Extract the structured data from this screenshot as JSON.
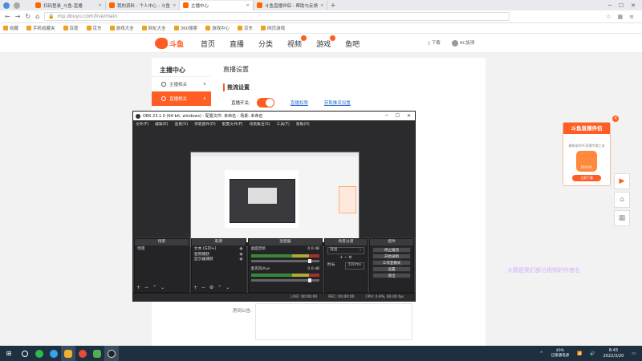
{
  "browser": {
    "tabs": [
      {
        "label": "扫码登录_斗鱼-直播",
        "active": false
      },
      {
        "label": "我的资料 - 个人中心 - 斗鱼",
        "active": false
      },
      {
        "label": "主播中心",
        "active": true
      },
      {
        "label": "斗鱼直播伴侣 - 帮助与反馈",
        "active": false
      }
    ],
    "new_tab": "+",
    "url": "mp.douyu.com/live/main",
    "bookmarks": [
      "收藏",
      "手机收藏夹",
      "百度",
      "京东",
      "游戏大全",
      "网址大全",
      "360搜索",
      "游戏中心",
      "京东",
      "网页游戏"
    ]
  },
  "douyu": {
    "logo_text": "斗鱼",
    "nav": [
      "首页",
      "直播",
      "分类",
      "视频",
      "游戏",
      "鱼吧"
    ],
    "right": {
      "download": "下载",
      "user": "AC旋律"
    },
    "sidebar_title": "主播中心",
    "sidebar_items": [
      {
        "label": "主播相关",
        "arrow": "∧"
      },
      {
        "label": "直播相关",
        "arrow": "∧"
      }
    ],
    "content_title": "直播设置",
    "section_title": "推流设置",
    "toggle_label": "直播开关:",
    "links": [
      "直播权限",
      "获取推流设置"
    ],
    "notice_label": "房间公告:"
  },
  "ad": {
    "title": "斗鱼直播伴侣",
    "subtitle": "最新版的PC直播专属工具",
    "app_label": "DOUYU",
    "download": "立即下载",
    "close": "×"
  },
  "watermark": "大鹅是我们部分视频的作者名",
  "obs": {
    "title": "OBS 23.1.0 (64-bit, windows) - 配置文件: 未命名 - 场景: 未命名",
    "menu": [
      "文件(F)",
      "编辑(E)",
      "查看(V)",
      "停靠部件(D)",
      "配置文件(P)",
      "场景集合(S)",
      "工具(T)",
      "帮助(H)"
    ],
    "docks": {
      "scenes": {
        "header": "场景",
        "items": [
          "场景"
        ]
      },
      "sources": {
        "header": "来源",
        "items": [
          "文本 (GDI+)",
          "音频捕获",
          "显示器捕获"
        ]
      },
      "mixer": {
        "header": "混音器",
        "channels": [
          {
            "name": "桌面音频",
            "level": "0.0 dB"
          },
          {
            "name": "麦克风/Aux",
            "level": "0.0 dB"
          }
        ]
      },
      "transitions": {
        "header": "场景过渡",
        "type": "淡出",
        "duration_label": "时长",
        "duration": "300ms"
      },
      "controls": {
        "header": "控件",
        "buttons": [
          "停止推流",
          "开始录制",
          "工作室模式",
          "设置",
          "退出"
        ]
      }
    },
    "status": {
      "live": "LIVE: 00:00:00",
      "rec": "REC: 00:00:00",
      "cpu": "CPU: 0.9%, 60.00 fps"
    }
  },
  "taskbar": {
    "time": "8:43",
    "date": "2022/3/20",
    "battery": "40%",
    "battery_status": "已接通电源"
  }
}
